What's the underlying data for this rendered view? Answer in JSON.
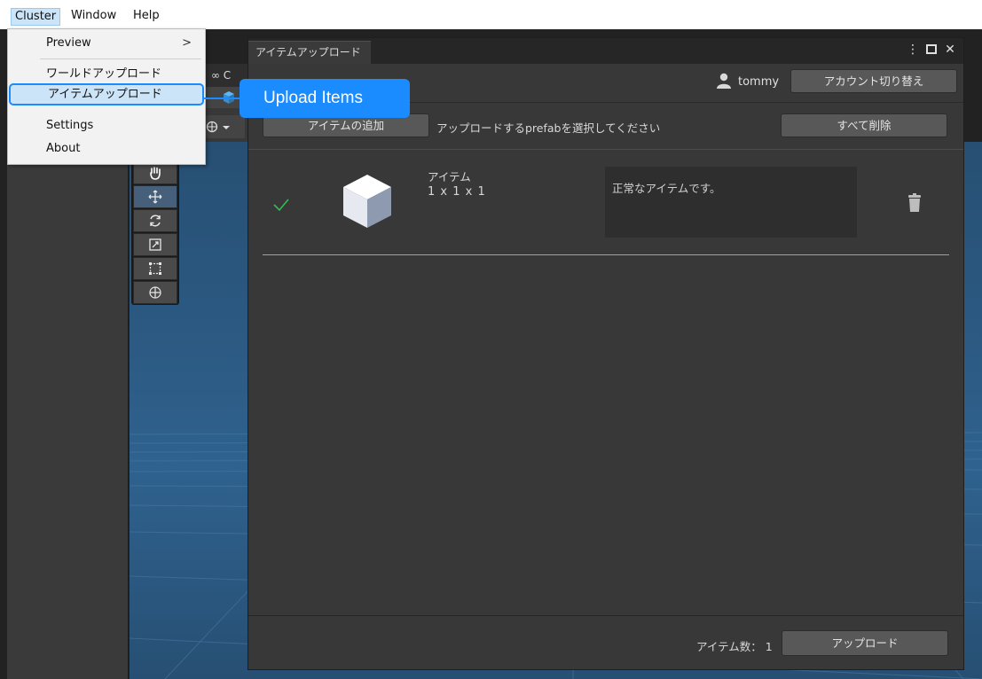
{
  "menubar": {
    "items": [
      "Cluster",
      "Window",
      "Help"
    ]
  },
  "cluster_menu": {
    "items": [
      {
        "label": "Preview",
        "has_submenu": true
      },
      {
        "label": "ワールドアップロード"
      },
      {
        "label": "アイテムアップロード",
        "highlighted": true
      },
      {
        "label": "Settings"
      },
      {
        "label": "About"
      }
    ],
    "submenu_arrow": ">"
  },
  "callout": {
    "text": "Upload Items",
    "color": "#1a8cff"
  },
  "editor": {
    "background_tab_snippet": "∞ C"
  },
  "upload_window": {
    "tab_title": "アイテムアップロード",
    "controls": {
      "more": "⋮",
      "close": "✕"
    },
    "account": {
      "username": "tommy",
      "switch_button": "アカウント切り替え"
    },
    "toolbar": {
      "add_item_button": "アイテムの追加",
      "select_prompt": "アップロードするprefabを選択してください",
      "delete_all_button": "すべて削除"
    },
    "items": [
      {
        "status_icon": "checkmark-icon",
        "status_color": "#2fbf4f",
        "thumbnail_icon": "cube-icon",
        "name": "アイテム",
        "size": "1 x 1 x 1",
        "message": "正常なアイテムです。",
        "delete_icon": "trash-icon"
      }
    ],
    "footer": {
      "item_count_label": "アイテム数：",
      "item_count": "1",
      "upload_button": "アップロード"
    }
  },
  "colors": {
    "window_bg": "#383838",
    "button_bg": "#585858",
    "scene_blue": "#2d5c86",
    "menu_highlight": "#cce4f7"
  }
}
